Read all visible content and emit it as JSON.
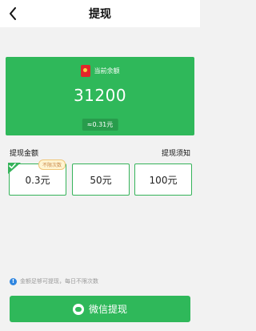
{
  "header": {
    "title": "提现",
    "back_icon": "chevron-left-icon"
  },
  "balance_card": {
    "label": "当前余额",
    "value": "31200",
    "rmb_equivalent": "≈0.31元",
    "background_color": "#2fb85a",
    "icon": "red-packet-icon"
  },
  "withdraw": {
    "section_label": "提现金额",
    "notice_link": "提现须知",
    "options": [
      {
        "label": "0.3元",
        "selected": true,
        "badge": "不限次数"
      },
      {
        "label": "50元",
        "selected": false
      },
      {
        "label": "100元",
        "selected": false
      }
    ]
  },
  "tip": {
    "text": "金额足够可提现，每日不限次数",
    "icon": "info-icon"
  },
  "submit_button": {
    "label": "微信提现",
    "icon": "wechat-icon"
  }
}
